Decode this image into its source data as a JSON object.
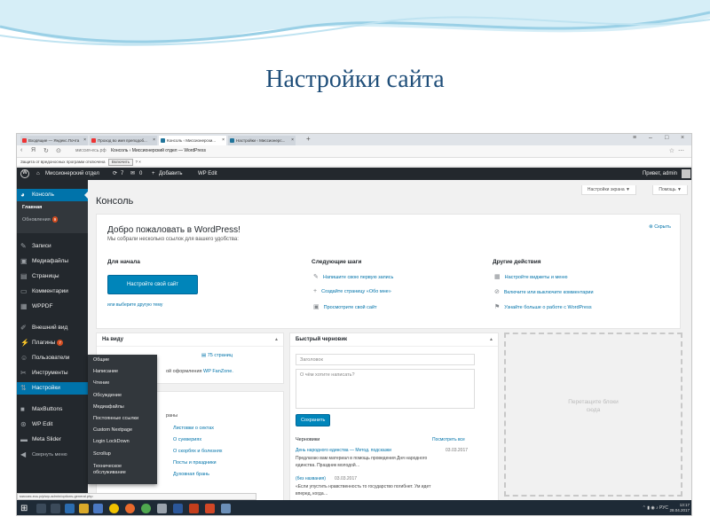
{
  "slide": {
    "title": "Настройки сайта"
  },
  "browser": {
    "tabs": [
      {
        "label": "Входящие — Яндекс.Почта",
        "active": false,
        "color": "#e33"
      },
      {
        "label": "Проход во имя преподоб...",
        "active": false,
        "color": "#e33"
      },
      {
        "label": "Консоль ‹ Миссионерски...",
        "active": true,
        "color": "#21759b"
      },
      {
        "label": "Настройки ‹ Миссионерс...",
        "active": false,
        "color": "#21759b"
      }
    ],
    "new_tab": "+",
    "url_host": "миссия-есь.рф",
    "url_title": "Консоль ‹ Миссионерский отдел — WordPress",
    "notice_text": "Защита от вредоносных программ отключена",
    "notice_button": "Включить"
  },
  "adminbar": {
    "site_name": "Миссионерский отдел",
    "updates_count": "7",
    "comments_count": "0",
    "add_label": "Добавить",
    "plugin_label": "WP Edit",
    "greeting": "Привет, admin"
  },
  "sidebar": {
    "console_label": "Консоль",
    "main_label": "Главная",
    "updates_label": "Обновления",
    "updates_badge": "9",
    "items": [
      {
        "label": "Записи",
        "icon": "pin-icon"
      },
      {
        "label": "Медиафайлы",
        "icon": "media-icon"
      },
      {
        "label": "Страницы",
        "icon": "pages-icon"
      },
      {
        "label": "Комментарии",
        "icon": "comments-icon"
      },
      {
        "label": "WPPDF",
        "icon": "pdf-icon"
      },
      {
        "label": "Внешний вид",
        "icon": "appearance-icon"
      },
      {
        "label": "Плагины",
        "icon": "plugins-icon",
        "badge": "7"
      },
      {
        "label": "Пользователи",
        "icon": "users-icon"
      },
      {
        "label": "Инструменты",
        "icon": "tools-icon"
      },
      {
        "label": "Настройки",
        "icon": "settings-icon"
      },
      {
        "label": "MaxButtons",
        "icon": "maxbuttons-icon"
      },
      {
        "label": "WP Edit",
        "icon": "wpedit-icon"
      },
      {
        "label": "Meta Slider",
        "icon": "slider-icon"
      },
      {
        "label": "Свернуть меню",
        "icon": "collapse-icon"
      }
    ]
  },
  "flyout": {
    "items": [
      "Общие",
      "Написание",
      "Чтение",
      "Обсуждение",
      "Медиафайлы",
      "Постоянные ссылки",
      "Custom Nextpage",
      "Login LockDown",
      "Scrollup",
      "Техническое обслуживание"
    ]
  },
  "content": {
    "heading": "Консоль",
    "screen_options": "Настройки экрана ▼",
    "help": "Помощь ▼",
    "welcome": {
      "title": "Добро пожаловать в WordPress!",
      "subtitle": "Мы собрали несколько ссылок для вашего удобства:",
      "dismiss": "Скрыть",
      "col1_heading": "Для начала",
      "customize_button": "Настройте свой сайт",
      "alt_link": "или выберите другую тему",
      "col2_heading": "Следующие шаги",
      "col2_links": [
        "Напишите свою первую запись",
        "Создайте страницу «Обо мне»",
        "Просмотрите свой сайт"
      ],
      "col3_heading": "Другие действия",
      "col3_links": [
        "Настройте виджеты и меню",
        "Включите или выключите комментарии",
        "Узнайте больше о работе с WordPress"
      ]
    },
    "glance": {
      "heading": "На виду",
      "pages": "75 страниц",
      "theme_text": "ой оформления",
      "theme_link": "WP FanZone."
    },
    "second_box": {
      "partial": "раны",
      "links": [
        "Листовки о сектах",
        "О суевериях",
        "О скорбях и болезнях",
        "Посты и праздники",
        "Духовная брань"
      ]
    },
    "quick_draft": {
      "heading": "Быстрый черновик",
      "title_placeholder": "Заголовок",
      "body_placeholder": "О чём хотите написать?",
      "save_button": "Сохранить",
      "drafts_heading": "Черновики",
      "view_all": "Посмотреть все",
      "draft1_title": "День народного единства — Метод. подсказки",
      "draft1_date": "03.03.2017",
      "draft1_text_1": "Предлагаю вам материал в помощь проведения Дня народного",
      "draft1_text_2": "единства. Праздник молодой…",
      "draft2_title": "(без названия)",
      "draft2_date": "03.03.2017",
      "draft2_text_1": "«Если упустить нравственность то государство погибнет. Ум идет",
      "draft2_text_2": "вперед, когда…"
    },
    "dropzone_1": "Перетащите блоки",
    "dropzone_2": "сюда"
  },
  "statusbar": "миссия-есь.рф/wp-admin/options-general.php",
  "taskbar": {
    "lang": "РУС",
    "time": "13:17",
    "date": "28.04.2017"
  },
  "colors": {
    "wp_blue": "#0073aa",
    "admin_dark": "#23282d",
    "button_blue": "#0085ba",
    "slide_title": "#1f4e79"
  }
}
